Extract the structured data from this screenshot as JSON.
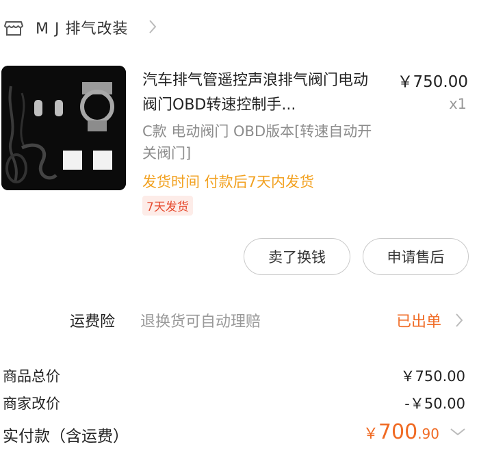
{
  "shop": {
    "name": "M J 排气改装"
  },
  "product": {
    "title": "汽车排气管遥控声浪排气阀门电动阀门OBD转速控制手...",
    "price": "￥750.00",
    "quantity": "x1",
    "spec": "C款 电动阀门 OBD版本[转速自动开关阀门]",
    "shipping": "发货时间 付款后7天内发货",
    "badge": "7天发货"
  },
  "actions": {
    "sell": "卖了换钱",
    "after_sale": "申请售后"
  },
  "insurance": {
    "label": "运费险",
    "desc": "退换货可自动理赔",
    "status": "已出单"
  },
  "totals": {
    "goods_label": "商品总价",
    "goods_value": "￥750.00",
    "adjust_label": "商家改价",
    "adjust_value": "-￥50.00",
    "pay_label": "实付款（含运费）",
    "pay_symbol": "￥",
    "pay_int": "700",
    "pay_dec": ".90"
  },
  "colors": {
    "accent": "#f06a23",
    "shipping": "#f2a120",
    "badge_text": "#e64a2e"
  }
}
